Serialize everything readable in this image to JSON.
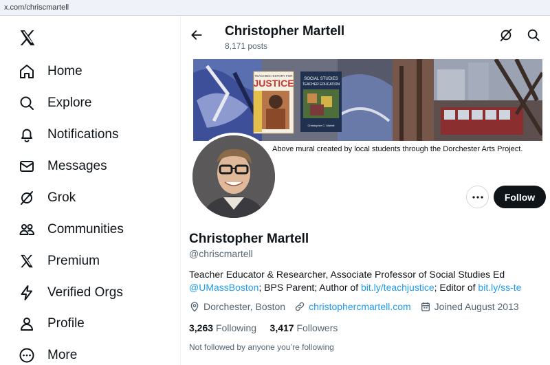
{
  "browser": {
    "url": "x.com/chriscmartell"
  },
  "sidebar": {
    "items": [
      {
        "label": "Home",
        "icon": "home-icon"
      },
      {
        "label": "Explore",
        "icon": "search-icon"
      },
      {
        "label": "Notifications",
        "icon": "bell-icon"
      },
      {
        "label": "Messages",
        "icon": "envelope-icon"
      },
      {
        "label": "Grok",
        "icon": "grok-icon"
      },
      {
        "label": "Communities",
        "icon": "people-icon"
      },
      {
        "label": "Premium",
        "icon": "x-logo-icon"
      },
      {
        "label": "Verified Orgs",
        "icon": "lightning-icon"
      },
      {
        "label": "Profile",
        "icon": "person-icon"
      },
      {
        "label": "More",
        "icon": "more-circle-icon"
      }
    ]
  },
  "header": {
    "name": "Christopher Martell",
    "posts": "8,171 posts"
  },
  "banner": {
    "caption": "Above mural created by local students through the Dorchester Arts Project.",
    "book1_title": "JUSTICE",
    "book1_top": "TEACHING HISTORY FOR",
    "book2_title": "SOCIAL STUDIES TEACHER EDUCATION",
    "book2_author": "Christopher C. Martell"
  },
  "profile": {
    "name": "Christopher Martell",
    "handle": "@chriscmartell",
    "bio_line1": "Teacher Educator & Researcher, Associate Professor of Social Studies Ed",
    "bio_mention": "@UMassBoston",
    "bio_mid": "; BPS Parent; Author of ",
    "bio_link1": "bit.ly/teachjustice",
    "bio_mid2": "; Editor of ",
    "bio_link2": "bit.ly/ss-te",
    "location": "Dorchester, Boston",
    "website": "christophercmartell.com",
    "joined": "Joined August 2013",
    "following_count": "3,263",
    "following_label": "Following",
    "followers_count": "3,417",
    "followers_label": "Followers",
    "not_followed": "Not followed by anyone you’re following"
  },
  "actions": {
    "follow": "Follow"
  },
  "colors": {
    "link": "#1d9bf0",
    "text": "#0f1419",
    "muted": "#536471",
    "follow_bg": "#0f1419"
  }
}
